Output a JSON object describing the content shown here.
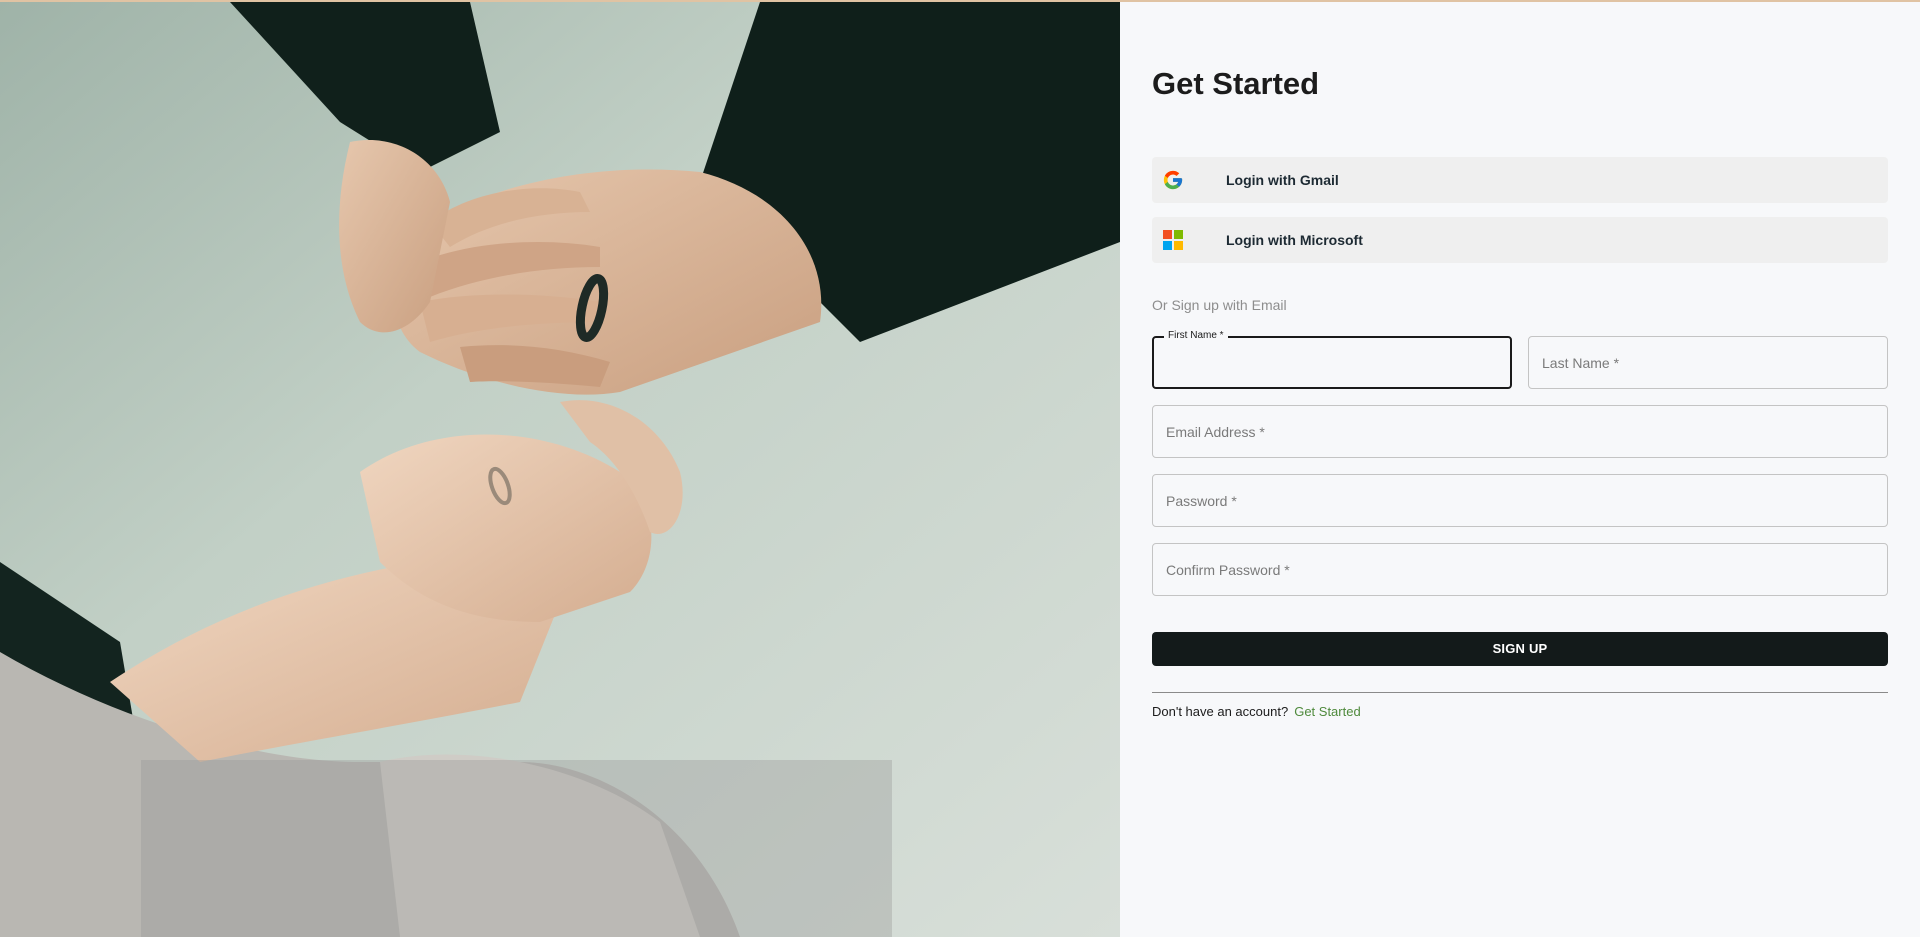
{
  "page": {
    "title": "Get Started",
    "accent_color": "#131a1a",
    "link_color": "#4f8a3c"
  },
  "hero": {
    "image_desc_icon": "hands-holding-photo"
  },
  "sso": {
    "gmail_label": "Login with Gmail",
    "gmail_icon": "google-icon",
    "microsoft_label": "Login with Microsoft",
    "microsoft_icon": "microsoft-icon"
  },
  "form": {
    "divider_text": "Or Sign up with Email",
    "first_name_label": "First Name *",
    "first_name_value": "",
    "last_name_placeholder": "Last Name *",
    "email_placeholder": "Email Address *",
    "password_placeholder": "Password *",
    "confirm_password_placeholder": "Confirm Password *",
    "submit_label": "SIGN UP"
  },
  "footer": {
    "prompt": "Don't have an account?",
    "link": "Get Started"
  }
}
